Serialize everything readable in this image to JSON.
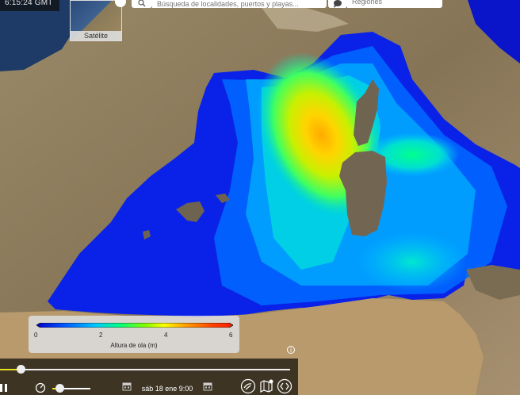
{
  "header": {
    "clock": "6:15:24 GMT",
    "layer_label": "Satélite",
    "search_placeholder": "Búsqueda de localidades, puertos y playas...",
    "region_label": "Regiones"
  },
  "legend": {
    "ticks": [
      "0",
      "2",
      "4",
      "6"
    ],
    "title": "Altura de ola (m)",
    "scale_colors": [
      "#0000cc",
      "#0055ff",
      "#00c8ff",
      "#00ff80",
      "#80ff00",
      "#ffff00",
      "#ffa500",
      "#ff4000",
      "#ff2000"
    ]
  },
  "controls": {
    "date_label": "sáb 18 ene 9:00",
    "timeline_progress": 0.07,
    "speed_level": 0.15,
    "icons": [
      "pause-icon",
      "gauge-icon",
      "calendar-prev-icon",
      "calendar-next-icon",
      "wind-icon",
      "map-layers-icon",
      "embed-code-icon"
    ]
  },
  "map": {
    "variable": "Altura de ola",
    "basemap": "Satélite",
    "colors": {
      "sea_deep": "#0a17e0",
      "sea_mid": "#0060ff",
      "max_wave": "#ffaa00",
      "land": "#8a7a5a"
    }
  }
}
